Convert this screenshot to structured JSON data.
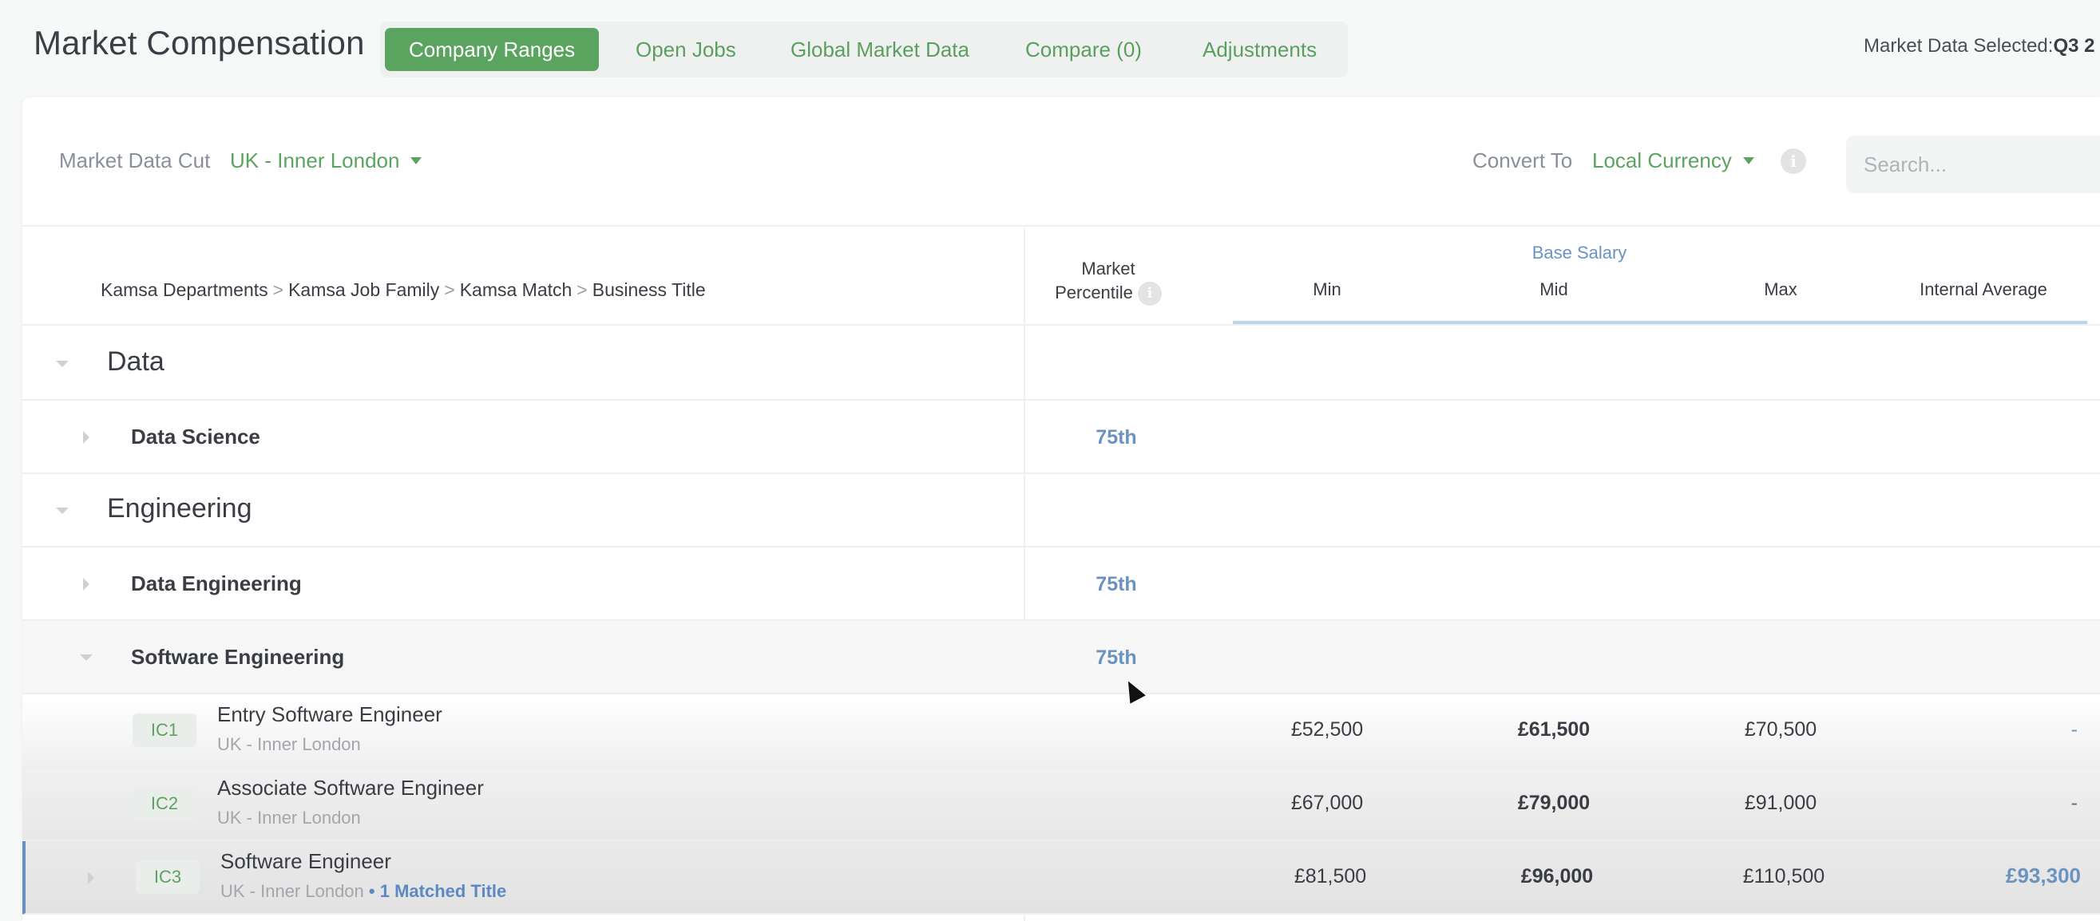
{
  "header": {
    "title": "Market Compensation",
    "tabs": [
      {
        "label": "Company Ranges",
        "active": true
      },
      {
        "label": "Open Jobs",
        "active": false
      },
      {
        "label": "Global Market Data",
        "active": false
      },
      {
        "label": "Compare (0)",
        "active": false
      },
      {
        "label": "Adjustments",
        "active": false
      }
    ],
    "market_data_selected_label": "Market Data Selected:",
    "market_data_selected_value": "Q3 2"
  },
  "filters": {
    "market_data_cut_label": "Market Data Cut",
    "market_data_cut_value": "UK - Inner London",
    "convert_to_label": "Convert To",
    "convert_to_value": "Local Currency",
    "search_placeholder": "Search...",
    "search_value": ""
  },
  "table": {
    "breadcrumb": [
      "Kamsa Departments",
      "Kamsa Job Family",
      "Kamsa Match",
      "Business Title"
    ],
    "breadcrumb_separator": ">",
    "market_percentile_header_line1": "Market",
    "market_percentile_header_line2": "Percentile",
    "group_header": "Base Salary",
    "columns": [
      "Min",
      "Mid",
      "Max",
      "Internal Average"
    ],
    "rows": [
      {
        "type": "department",
        "name": "Data",
        "expanded": true
      },
      {
        "type": "family",
        "name": "Data Science",
        "expanded": false,
        "percentile": "75th"
      },
      {
        "type": "department",
        "name": "Engineering",
        "expanded": true
      },
      {
        "type": "family",
        "name": "Data Engineering",
        "expanded": false,
        "percentile": "75th"
      },
      {
        "type": "family",
        "name": "Software Engineering",
        "expanded": true,
        "percentile": "75th"
      },
      {
        "type": "job",
        "level": "IC1",
        "title": "Entry Software Engineer",
        "location": "UK - Inner London",
        "matched": "",
        "min": "£52,500",
        "mid": "£61,500",
        "max": "£70,500",
        "internal_average": "-"
      },
      {
        "type": "job",
        "level": "IC2",
        "title": "Associate Software Engineer",
        "location": "UK - Inner London",
        "matched": "",
        "min": "£67,000",
        "mid": "£79,000",
        "max": "£91,000",
        "internal_average": "-"
      },
      {
        "type": "job",
        "level": "IC3",
        "title": "Software Engineer",
        "location": "UK - Inner London",
        "matched": "• 1 Matched Title",
        "min": "£81,500",
        "mid": "£96,000",
        "max": "£110,500",
        "internal_average": "£93,300"
      }
    ]
  },
  "icons": {
    "info": "i"
  },
  "colors": {
    "accent_green": "#5ba460",
    "link_blue": "#6b93c0"
  }
}
